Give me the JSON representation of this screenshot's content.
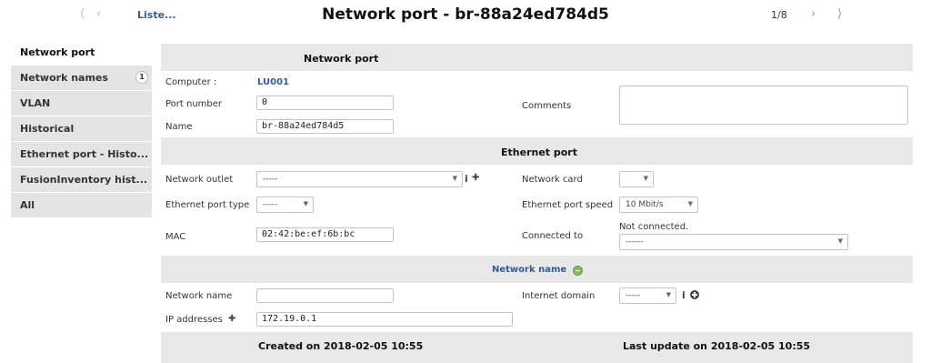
{
  "nav": {
    "list_label": "Liste...",
    "title": "Network port - br-88a24ed784d5",
    "counter": "1/8",
    "first_glyph": "⟨",
    "prev_glyph": "‹",
    "next_glyph": "›",
    "last_glyph": "⟩"
  },
  "sidebar": {
    "items": [
      {
        "label": "Network port",
        "active": true
      },
      {
        "label": "Network names",
        "badge": "1"
      },
      {
        "label": "VLAN"
      },
      {
        "label": "Historical"
      },
      {
        "label": "Ethernet port - Histo..."
      },
      {
        "label": "FusionInventory hist..."
      },
      {
        "label": "All"
      }
    ]
  },
  "network_port": {
    "header": "Network port",
    "computer_label": "Computer :",
    "computer_value": "LU001",
    "port_number_label": "Port number",
    "port_number_value": "0",
    "name_label": "Name",
    "name_value": "br-88a24ed784d5",
    "comments_label": "Comments",
    "comments_value": ""
  },
  "ethernet_port": {
    "header": "Ethernet port",
    "outlet_label": "Network outlet",
    "outlet_value": "-----",
    "card_label": "Network card",
    "card_value": "",
    "type_label": "Ethernet port type",
    "type_value": "-----",
    "speed_label": "Ethernet port speed",
    "speed_value": "10 Mbit/s",
    "mac_label": "MAC",
    "mac_value": "02:42:be:ef:6b:bc",
    "connected_label": "Connected to",
    "connected_status": "Not connected.",
    "connected_value": "------",
    "info_glyph": "i",
    "plus_glyph": "✚"
  },
  "network_name": {
    "header": "Network name",
    "name_label": "Network name",
    "name_value": "",
    "domain_label": "Internet domain",
    "domain_value": "-----",
    "ip_label": "IP addresses",
    "ip_value": "172.19.0.1",
    "info_glyph": "i",
    "plus_glyph": "✚"
  },
  "footer": {
    "created": "Created on 2018-02-05 10:55",
    "updated": "Last update on 2018-02-05 10:55"
  },
  "colors": {
    "link": "#3a5a8c",
    "band": "#e8e8e8",
    "tab": "#e4e4e4",
    "minus_icon": "#8fb56a"
  }
}
